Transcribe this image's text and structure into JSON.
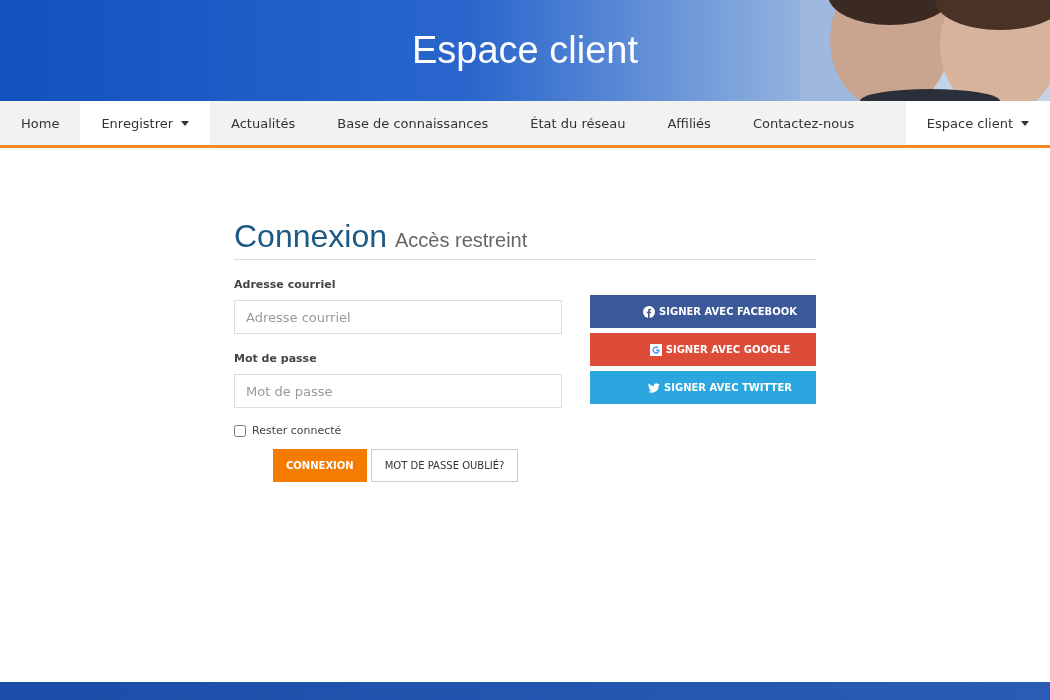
{
  "header": {
    "title": "Espace client"
  },
  "nav": {
    "items": [
      {
        "label": "Home",
        "selected": false,
        "dropdown": false
      },
      {
        "label": "Enregistrer",
        "selected": true,
        "dropdown": true
      },
      {
        "label": "Actualités",
        "selected": false,
        "dropdown": false
      },
      {
        "label": "Base de connaissances",
        "selected": false,
        "dropdown": false
      },
      {
        "label": "État du réseau",
        "selected": false,
        "dropdown": false
      },
      {
        "label": "Affiliés",
        "selected": false,
        "dropdown": false
      },
      {
        "label": "Contactez-nous",
        "selected": false,
        "dropdown": false
      }
    ],
    "right_item": {
      "label": "Espace client",
      "selected": true,
      "dropdown": true
    }
  },
  "login": {
    "title": "Connexion",
    "subtitle": "Accès restreint",
    "fields": [
      {
        "label": "Adresse courriel",
        "placeholder": "Adresse courriel"
      },
      {
        "label": "Mot de passe",
        "placeholder": "Mot de passe"
      }
    ],
    "remember": {
      "label": "Rester connecté",
      "checked": false
    },
    "submit": "CONNEXION",
    "forgot": "MOT DE PASSE OUBLIÉ?",
    "social": [
      {
        "kind": "facebook",
        "label": "SIGNER AVEC FACEBOOK",
        "color": "#3b5998"
      },
      {
        "kind": "google",
        "label": "SIGNER AVEC GOOGLE",
        "color": "#dd4b39"
      },
      {
        "kind": "twitter",
        "label": "SIGNER AVEC TWITTER",
        "color": "#2ba6de"
      }
    ]
  }
}
